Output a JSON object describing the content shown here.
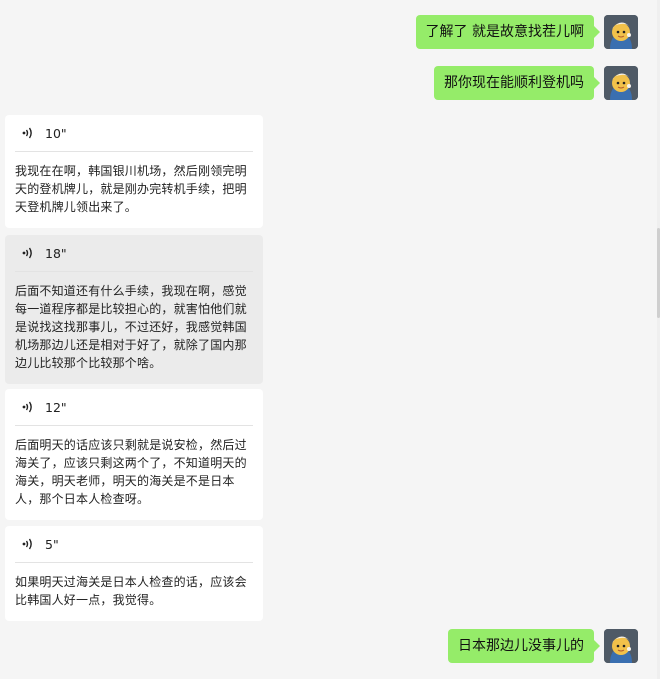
{
  "messages": {
    "out_1": {
      "text": "了解了  就是故意找茬儿啊"
    },
    "out_2": {
      "text": "那你现在能顺利登机吗"
    },
    "voice_1": {
      "duration": "10\"",
      "text": "我现在在啊，韩国银川机场，然后刚领完明天的登机牌儿，就是刚办完转机手续，把明天登机牌儿领出来了。"
    },
    "voice_2": {
      "duration": "18\"",
      "text": "后面不知道还有什么手续，我现在啊，感觉每一道程序都是比较担心的，就害怕他们就是说找这找那事儿，不过还好，我感觉韩国机场那边儿还是相对于好了，就除了国内那边儿比较那个比较那个啥。"
    },
    "voice_3": {
      "duration": "12\"",
      "text": "后面明天的话应该只剩就是说安检，然后过海关了，应该只剩这两个了，不知道明天的海关，明天老师，明天的海关是不是日本人，那个日本人检查呀。"
    },
    "voice_4": {
      "duration": "5\"",
      "text": "如果明天过海关是日本人检查的话，应该会比韩国人好一点，我觉得。"
    },
    "out_3": {
      "text": "日本那边儿没事儿的"
    }
  },
  "colors": {
    "background": "#f5f5f5",
    "outgoing_bubble": "#95ec69",
    "incoming_card": "#ffffff",
    "incoming_card_highlight": "#ebebeb"
  },
  "icons": {
    "avatar": "cartoon-girl-avatar-icon",
    "voice": "voice-wave-icon"
  }
}
